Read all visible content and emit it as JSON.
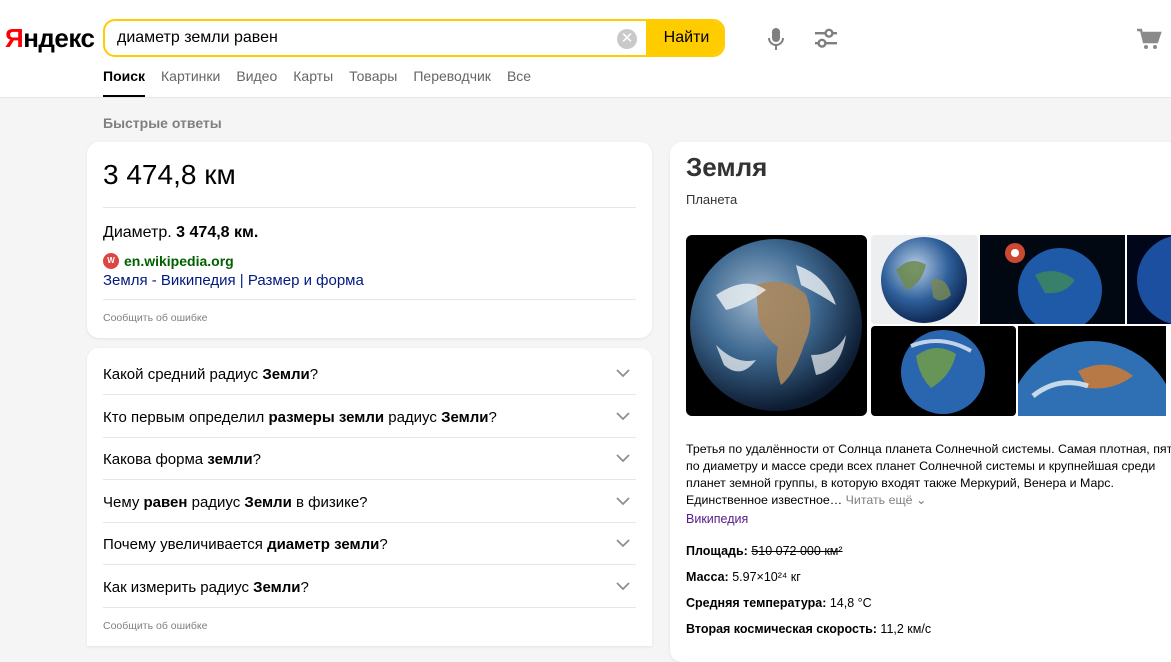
{
  "header": {
    "logo_ya": "Я",
    "logo_rest": "ндекс",
    "search_value": "диаметр земли равен",
    "find_label": "Найти",
    "tabs": [
      "Поиск",
      "Картинки",
      "Видео",
      "Карты",
      "Товары",
      "Переводчик",
      "Все"
    ]
  },
  "quick": {
    "section_title": "Быстрые ответы",
    "answer": "3 474,8 км",
    "snippet_prefix": "Диаметр.",
    "snippet_bold": "3 474,8 км.",
    "source_domain": "en.wikipedia.org",
    "source_link": "Земля - Википедия | Размер и форма",
    "report": "Сообщить об ошибке"
  },
  "faq": {
    "items": [
      {
        "parts": [
          "Какой средний радиус ",
          "Земли",
          "?"
        ]
      },
      {
        "parts": [
          "Кто первым определил ",
          "размеры земли",
          " радиус ",
          "Земли",
          "?"
        ]
      },
      {
        "parts": [
          "Какова форма ",
          "земли",
          "?"
        ]
      },
      {
        "parts": [
          "Чему ",
          "равен",
          " радиус ",
          "Земли",
          " в физике?"
        ]
      },
      {
        "parts": [
          "Почему увеличивается ",
          "диаметр земли",
          "?"
        ]
      },
      {
        "parts": [
          "Как измерить радиус ",
          "Земли",
          "?"
        ]
      }
    ],
    "report": "Сообщить об ошибке"
  },
  "knowledge": {
    "title": "Земля",
    "subtitle": "Планета",
    "description": "Третья по удалённости от Солнца планета Солнечной системы. Самая плотная, пятая по диаметру и массе среди всех планет Солнечной системы и крупнейшая среди планет земной группы, в которую входят также Меркурий, Венера и Марс. Единственное известное…",
    "read_more": "Читать ещё",
    "wiki": "Википедия",
    "facts": [
      {
        "label": "Площадь:",
        "value": "510 072 000 км²"
      },
      {
        "label": "Масса:",
        "value": "5.97×10²⁴ кг"
      },
      {
        "label": "Средняя температура:",
        "value": "14,8 °C"
      },
      {
        "label": "Вторая космическая скорость:",
        "value": "11,2 км/с"
      }
    ]
  },
  "colors": {
    "accent": "#ffcc00",
    "logo_red": "#ff0000",
    "link": "#001a80",
    "source_green": "#006000",
    "wiki_purple": "#551a8b"
  }
}
